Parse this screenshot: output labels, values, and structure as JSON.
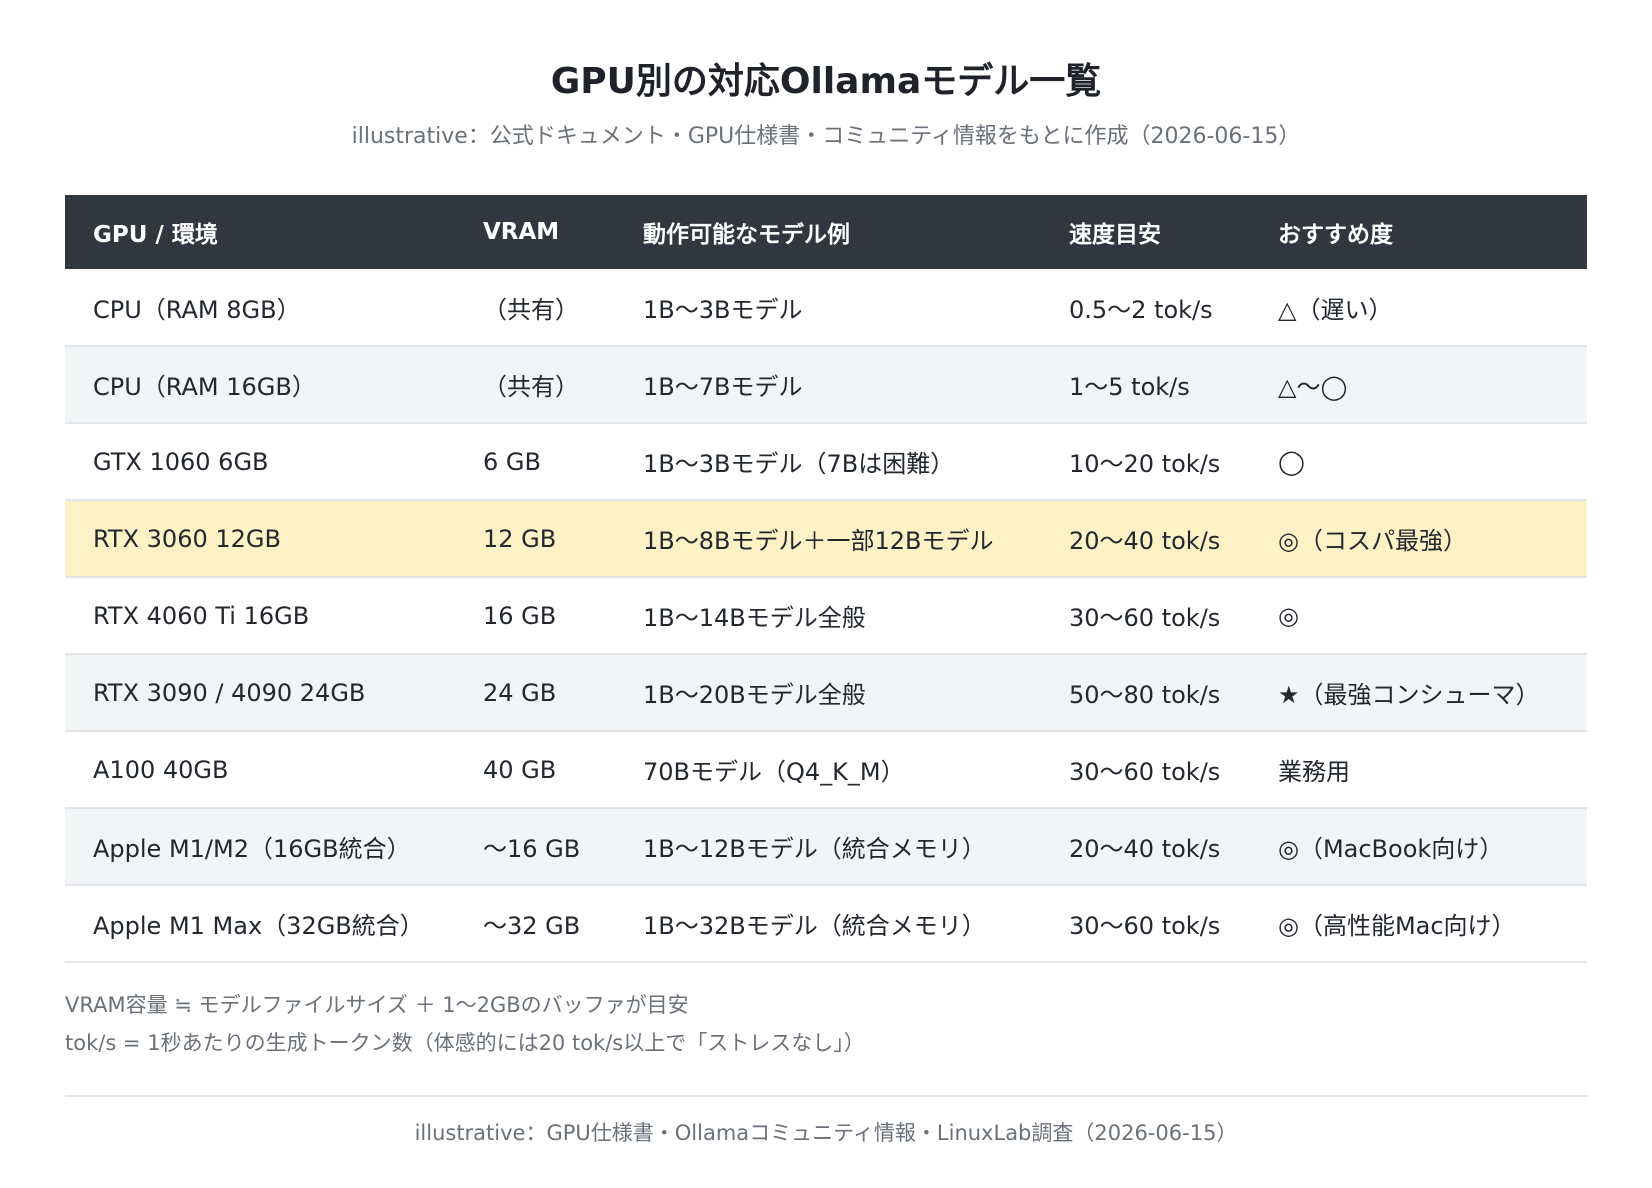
{
  "title": "GPU別の対応Ollamaモデル一覧",
  "subtitle": "illustrative：公式ドキュメント・GPU仕様書・コミュニティ情報をもとに作成（2026-06-15）",
  "table": {
    "headers": [
      "GPU / 環境",
      "VRAM",
      "動作可能なモデル例",
      "速度目安",
      "おすすめ度"
    ],
    "rows": [
      {
        "gpu": "CPU（RAM 8GB）",
        "vram": "（共有）",
        "models": "1B〜3Bモデル",
        "speed": "0.5〜2 tok/s",
        "rating": "△（遅い）",
        "highlight": false
      },
      {
        "gpu": "CPU（RAM 16GB）",
        "vram": "（共有）",
        "models": "1B〜7Bモデル",
        "speed": "1〜5 tok/s",
        "rating": "△〜◯",
        "highlight": false
      },
      {
        "gpu": "GTX 1060 6GB",
        "vram": "6 GB",
        "models": "1B〜3Bモデル（7Bは困難）",
        "speed": "10〜20 tok/s",
        "rating": "◯",
        "highlight": false
      },
      {
        "gpu": "RTX 3060 12GB",
        "vram": "12 GB",
        "models": "1B〜8Bモデル＋一部12Bモデル",
        "speed": "20〜40 tok/s",
        "rating": "◎（コスパ最強）",
        "highlight": true
      },
      {
        "gpu": "RTX 4060 Ti 16GB",
        "vram": "16 GB",
        "models": "1B〜14Bモデル全般",
        "speed": "30〜60 tok/s",
        "rating": "◎",
        "highlight": false
      },
      {
        "gpu": "RTX 3090 / 4090 24GB",
        "vram": "24 GB",
        "models": "1B〜20Bモデル全般",
        "speed": "50〜80 tok/s",
        "rating": "★（最強コンシューマ）",
        "highlight": false
      },
      {
        "gpu": "A100 40GB",
        "vram": "40 GB",
        "models": "70Bモデル（Q4_K_M）",
        "speed": "30〜60 tok/s",
        "rating": "業務用",
        "highlight": false
      },
      {
        "gpu": "Apple M1/M2（16GB統合）",
        "vram": "〜16 GB",
        "models": "1B〜12Bモデル（統合メモリ）",
        "speed": "20〜40 tok/s",
        "rating": "◎（MacBook向け）",
        "highlight": false
      },
      {
        "gpu": "Apple M1 Max（32GB統合）",
        "vram": "〜32 GB",
        "models": "1B〜32Bモデル（統合メモリ）",
        "speed": "30〜60 tok/s",
        "rating": "◎（高性能Mac向け）",
        "highlight": false
      }
    ]
  },
  "notes": [
    "VRAM容量 ≒ モデルファイルサイズ ＋ 1〜2GBのバッファが目安",
    "tok/s = 1秒あたりの生成トークン数（体感的には20 tok/s以上で「ストレスなし」）"
  ],
  "footer": "illustrative：GPU仕様書・Ollamaコミュニティ情報・LinuxLab調査（2026-06-15）",
  "colors": {
    "header_bg": "#32373f",
    "row_alt_bg": "#f2f4f6",
    "highlight_bg": "#fdf1c6",
    "muted_text": "#6b7178"
  }
}
